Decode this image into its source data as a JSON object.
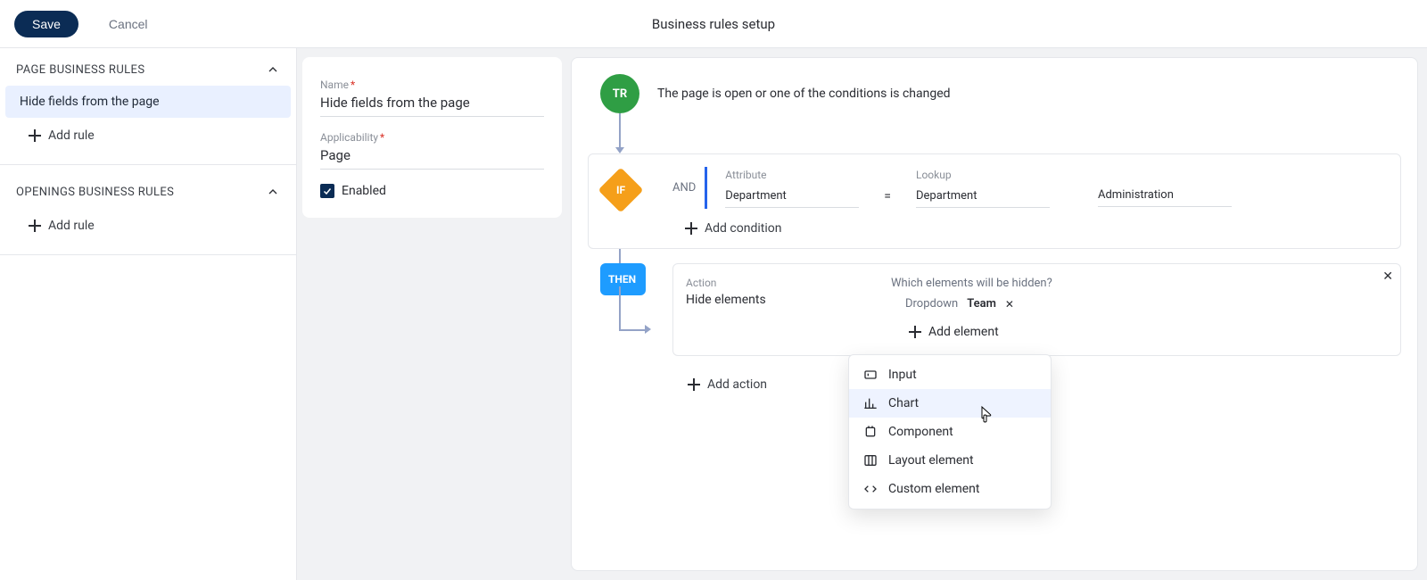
{
  "topbar": {
    "save": "Save",
    "cancel": "Cancel",
    "title": "Business rules setup"
  },
  "sidebar": {
    "sections": [
      {
        "title": "PAGE BUSINESS RULES",
        "items": [
          {
            "label": "Hide fields from the page",
            "active": true
          }
        ],
        "add": "Add rule"
      },
      {
        "title": "OPENINGS BUSINESS RULES",
        "items": [],
        "add": "Add rule"
      }
    ]
  },
  "form": {
    "name_label": "Name",
    "name_value": "Hide fields from the page",
    "app_label": "Applicability",
    "app_value": "Page",
    "enabled_label": "Enabled"
  },
  "flow": {
    "trigger_badge": "TR",
    "trigger_text": "The page is open or one of the conditions is changed",
    "if_badge": "IF",
    "logic": "AND",
    "condition": {
      "left_label": "Attribute",
      "left_value": "Department",
      "op": "=",
      "right_label": "Lookup",
      "right_lookup": "Department",
      "right_value": "Administration"
    },
    "add_condition": "Add condition",
    "then_badge": "THEN",
    "action": {
      "label": "Action",
      "value": "Hide elements",
      "question": "Which elements will be hidden?",
      "tag_type": "Dropdown",
      "tag_name": "Team",
      "add_element": "Add element"
    },
    "add_action": "Add action"
  },
  "menu": {
    "items": [
      {
        "label": "Input",
        "icon": "input"
      },
      {
        "label": "Chart",
        "icon": "chart",
        "hover": true
      },
      {
        "label": "Component",
        "icon": "component"
      },
      {
        "label": "Layout element",
        "icon": "layout"
      },
      {
        "label": "Custom element",
        "icon": "custom"
      }
    ]
  }
}
